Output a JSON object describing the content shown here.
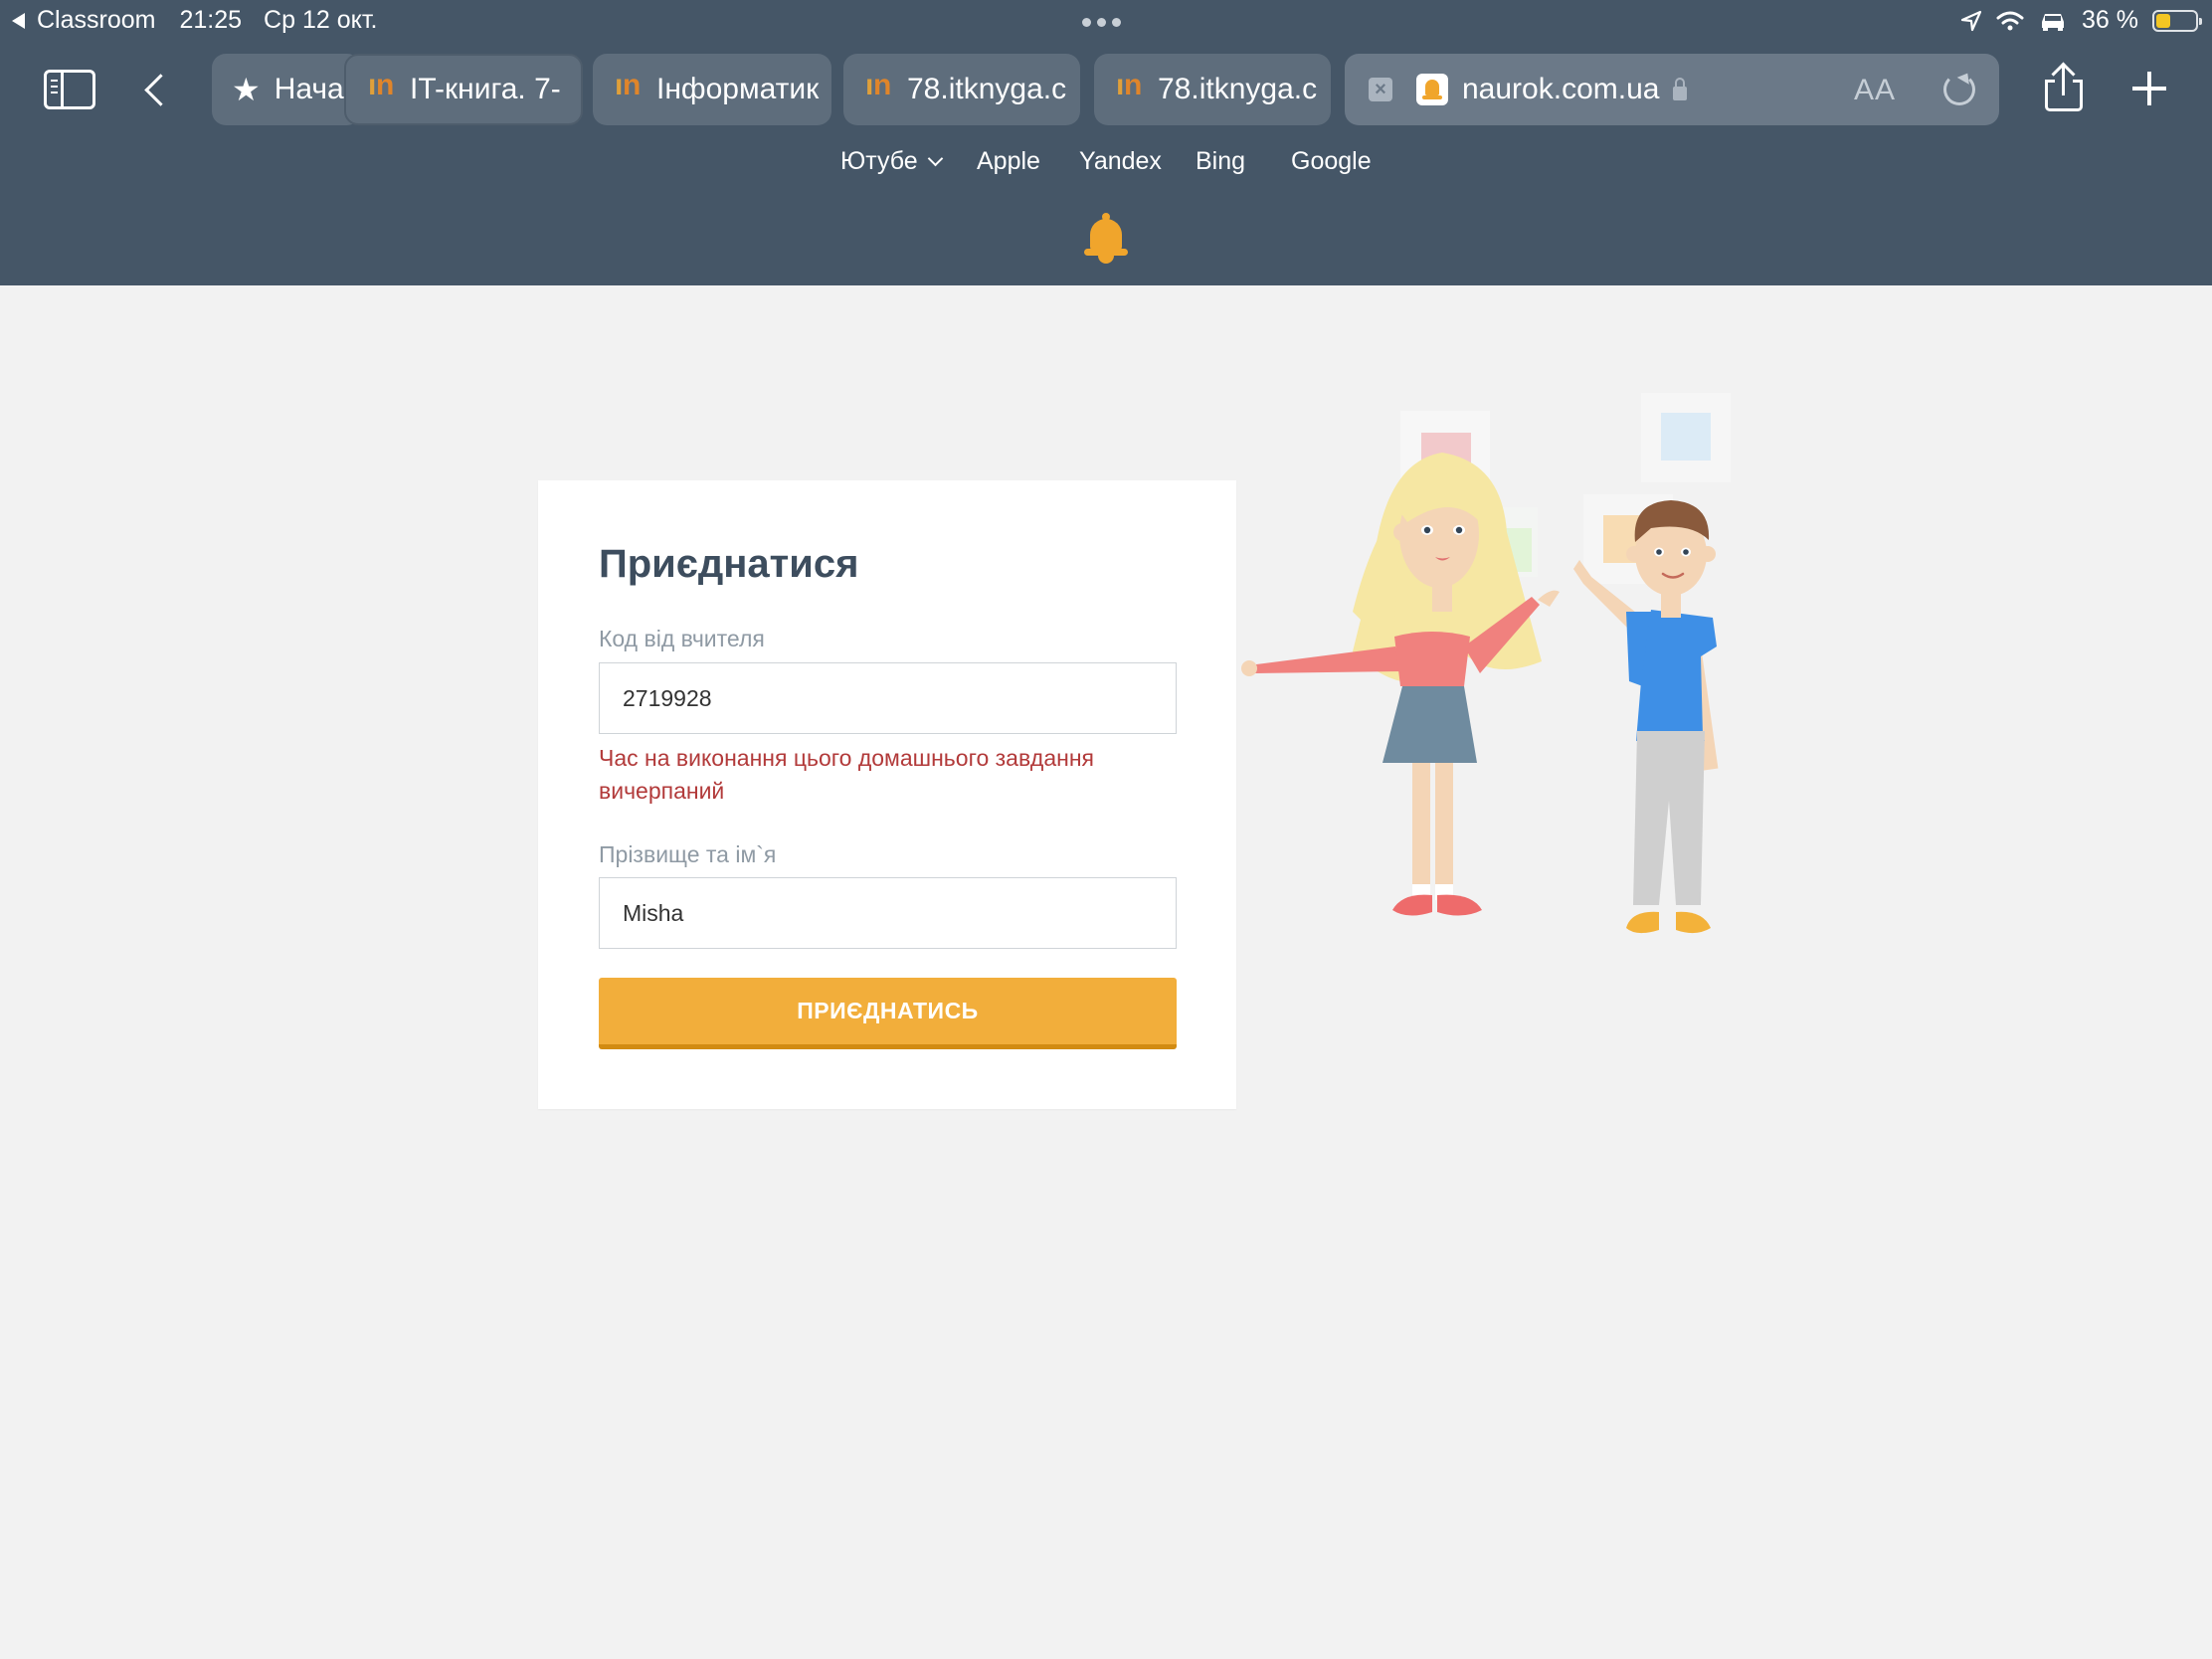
{
  "status_bar": {
    "app": "Classroom",
    "time": "21:25",
    "date": "Ср 12 окт.",
    "battery_text": "36 %",
    "battery_level": 0.36
  },
  "tabs": [
    {
      "label": "Нача",
      "icon": "star-icon"
    },
    {
      "label": "IT-книга. 7-",
      "icon": "itknyga-favicon"
    },
    {
      "label": "Інформатик",
      "icon": "itknyga-favicon"
    },
    {
      "label": "78.itknyga.c",
      "icon": "itknyga-favicon"
    },
    {
      "label": "78.itknyga.c",
      "icon": "itknyga-favicon"
    }
  ],
  "address": {
    "domain": "naurok.com.ua",
    "aa_label": "AA"
  },
  "favorites": [
    {
      "label": "Ютубе",
      "has_dropdown": true
    },
    {
      "label": "Apple"
    },
    {
      "label": "Yandex"
    },
    {
      "label": "Bing"
    },
    {
      "label": "Google"
    }
  ],
  "join_form": {
    "title": "Приєднатися",
    "code_label": "Код від вчителя",
    "code_value": "2719928",
    "error": "Час на виконання цього домашнього завдання вичерпаний",
    "name_label": "Прізвище та ім`я",
    "name_value": "Misha",
    "submit_label": "ПРИЄДНАТИСЬ"
  },
  "colors": {
    "chrome_bg": "#455667",
    "accent": "#f2ae3b",
    "error": "#b23a3a",
    "title": "#3d4d5e"
  }
}
